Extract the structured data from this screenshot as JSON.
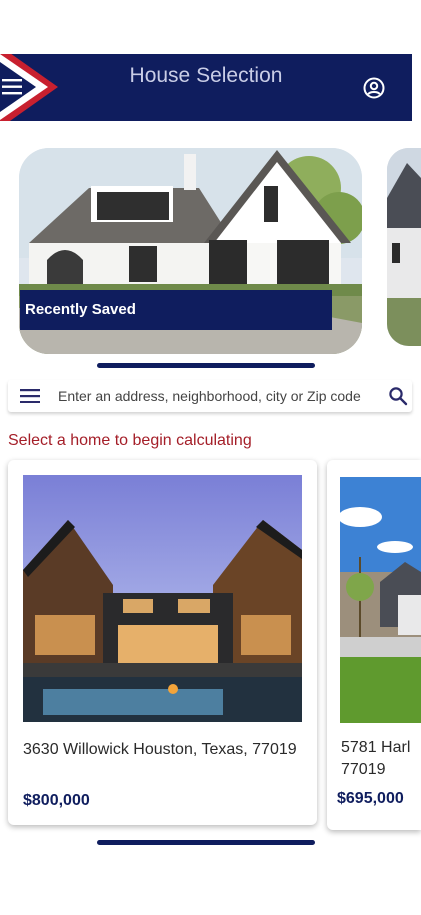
{
  "header": {
    "title": "House Selection",
    "menu_icon": "menu-icon",
    "profile_icon": "account-circle-icon",
    "colors": {
      "background": "#0f1d5e",
      "flag_red": "#c8202f"
    }
  },
  "recently_saved": {
    "label": "Recently Saved"
  },
  "search": {
    "placeholder": "Enter an address, neighborhood, city or Zip code",
    "menu_icon": "menu-icon",
    "search_icon": "search-icon"
  },
  "prompt": "Select a home to begin calculating",
  "listings": [
    {
      "address": "3630 Willowick Houston, Texas, 77019",
      "price": "$800,000"
    },
    {
      "address": "5781 Harl",
      "zip": "77019",
      "price": "$695,000"
    }
  ]
}
